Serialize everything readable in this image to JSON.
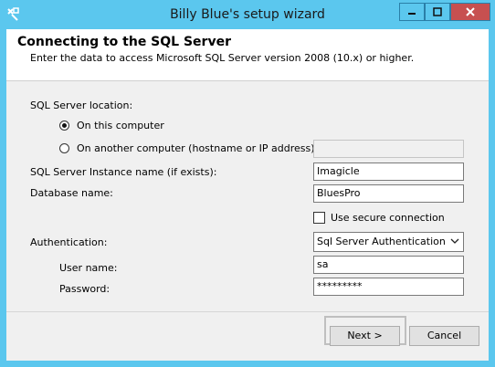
{
  "window": {
    "title": "Billy Blue's setup wizard",
    "controls": [
      "minimize",
      "maximize",
      "close"
    ]
  },
  "header": {
    "title": "Connecting to the SQL Server",
    "subtitle": "Enter the data to access Microsoft SQL Server version 2008 (10.x) or higher."
  },
  "form": {
    "location_label": "SQL Server location:",
    "radio_this_computer": "On this computer",
    "radio_another_computer": "On another computer (hostname or IP address):",
    "selected_location": "On this computer",
    "hostname_value": "",
    "instance_label": "SQL Server Instance name (if exists):",
    "instance_value": "Imagicle",
    "database_label": "Database name:",
    "database_value": "BluesPro",
    "secure_label": "Use secure connection",
    "secure_checked": false,
    "auth_label": "Authentication:",
    "auth_value": "Sql Server Authentication",
    "username_label": "User name:",
    "username_value": "sa",
    "password_label": "Password:",
    "password_value": "*********"
  },
  "footer": {
    "next_label": "Next >",
    "cancel_label": "Cancel"
  },
  "colors": {
    "titlebar": "#5bc7ee",
    "close_button": "#c75050",
    "panel": "#f0f0f0"
  }
}
